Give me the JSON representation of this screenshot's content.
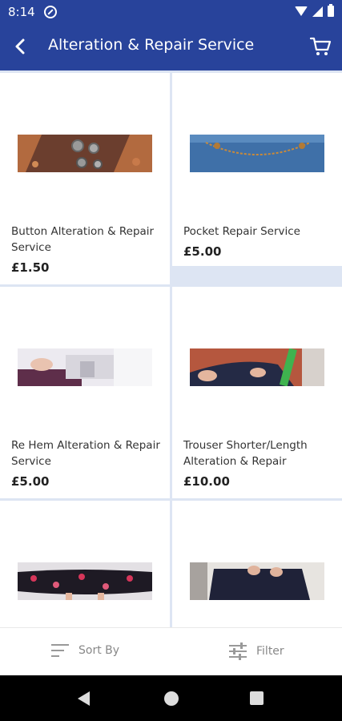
{
  "status_bar": {
    "time": "8:14"
  },
  "header": {
    "title": "Alteration & Repair Service",
    "back_icon": "back-arrow-icon",
    "cart_icon": "cart-icon"
  },
  "products": [
    {
      "name": "Button Alteration & Repair Service",
      "price": "£1.50",
      "image": "buttons-photo"
    },
    {
      "name": "Pocket Repair Service",
      "price": "£5.00",
      "image": "denim-pocket-photo"
    },
    {
      "name": "Re Hem Alteration & Repair Service",
      "price": "£5.00",
      "image": "sewing-machine-photo"
    },
    {
      "name": "Trouser Shorter/Length Alteration & Repair",
      "price": "£10.00",
      "image": "trouser-measure-photo"
    },
    {
      "name": "",
      "price": "",
      "image": "floral-skirt-photo"
    },
    {
      "name": "",
      "price": "",
      "image": "waistband-photo"
    }
  ],
  "bottom_bar": {
    "sort_label": "Sort By",
    "filter_label": "Filter"
  },
  "colors": {
    "primary": "#28439b",
    "grid_gap": "#dde5f3"
  }
}
